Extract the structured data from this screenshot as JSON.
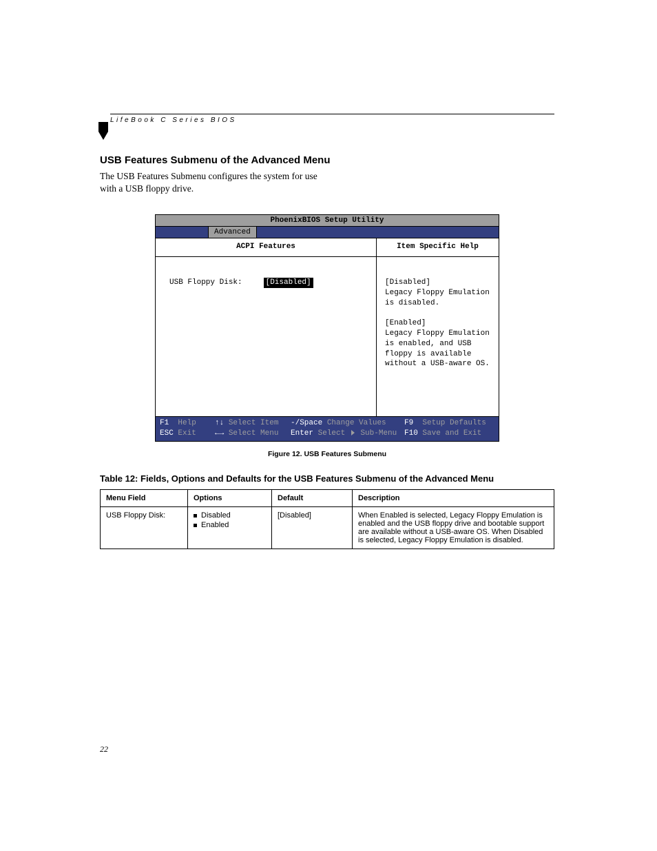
{
  "runningHead": "LifeBook C Series BIOS",
  "heading": "USB Features Submenu of the Advanced Menu",
  "intro": "The USB Features Submenu configures the system for use with a USB floppy drive.",
  "bios": {
    "title": "PhoenixBIOS Setup Utility",
    "activeTab": "Advanced",
    "leftHeader": "ACPI Features",
    "field": {
      "label": "USB Floppy Disk:",
      "value": "[Disabled]"
    },
    "rightHeader": "Item Specific Help",
    "help1_title": "[Disabled]",
    "help1_body": "Legacy Floppy Emulation is disabled.",
    "help2_title": "[Enabled]",
    "help2_body": "Legacy Floppy Emulation is enabled, and USB floppy is available without a USB-aware OS.",
    "footer": {
      "r1c1k": "F1",
      "r1c1t": "Help",
      "r1c2k": "↑↓",
      "r1c2t": "Select Item",
      "r1c3k": "-/Space",
      "r1c3t": "Change Values",
      "r1c4k": "F9",
      "r1c4t": "Setup Defaults",
      "r2c1k": "ESC",
      "r2c1t": "Exit",
      "r2c2k": "←→",
      "r2c2t": "Select Menu",
      "r2c3k": "Enter",
      "r2c3t": "Select ▶ Sub-Menu",
      "r2c4k": "F10",
      "r2c4t": "Save and Exit"
    }
  },
  "figCaption": "Figure 12.  USB Features Submenu",
  "tableTitle": "Table 12: Fields, Options and Defaults for the USB Features Submenu of the Advanced Menu",
  "table": {
    "h1": "Menu Field",
    "h2": "Options",
    "h3": "Default",
    "h4": "Description",
    "row1": {
      "field": "USB Floppy Disk:",
      "opt1": "Disabled",
      "opt2": "Enabled",
      "def": "[Disabled]",
      "desc": "When Enabled is selected, Legacy Floppy Emulation is enabled and the USB floppy drive and bootable support are available without a USB-aware OS. When Disabled is selected, Legacy Floppy Emulation is disabled."
    }
  },
  "pageNumber": "22"
}
